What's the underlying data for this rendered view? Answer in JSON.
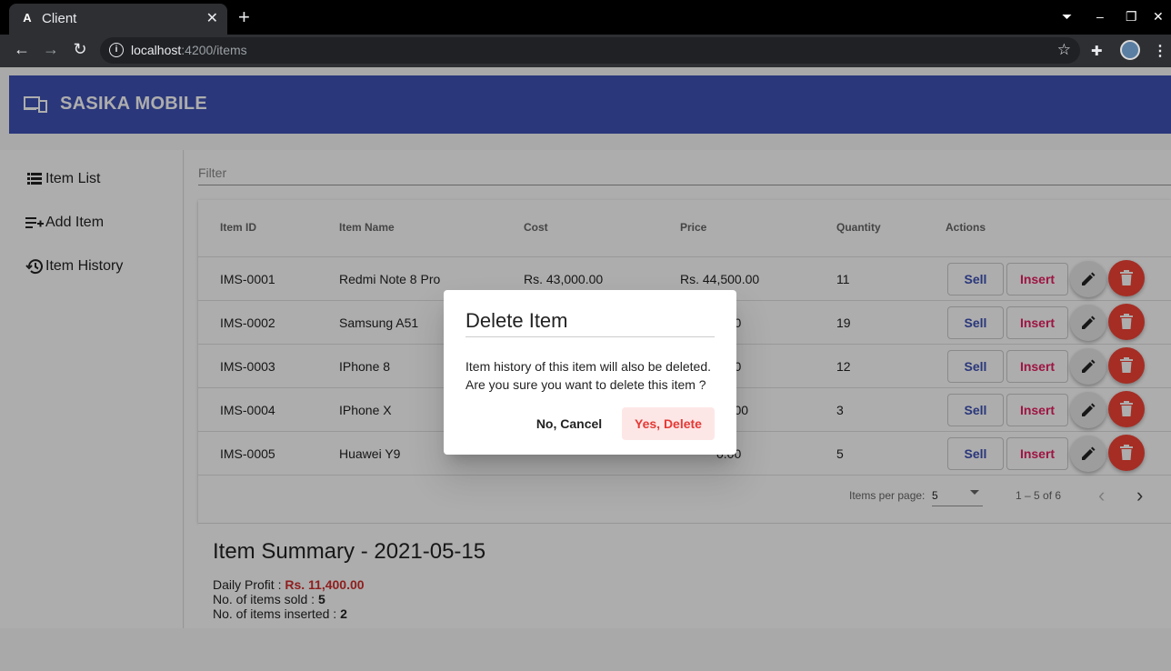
{
  "browser": {
    "tab_title": "Client",
    "url_host": "localhost",
    "url_path": ":4200/items"
  },
  "app": {
    "brand": "SASIKA MOBILE",
    "accent_color": "#3f51b5",
    "nav": [
      {
        "label": "Item List",
        "icon": "list-icon"
      },
      {
        "label": "Add Item",
        "icon": "playlist-add-icon"
      },
      {
        "label": "Item History",
        "icon": "history-icon"
      }
    ],
    "filter_placeholder": "Filter",
    "table": {
      "headers": [
        "Item ID",
        "Item Name",
        "Cost",
        "Price",
        "Quantity",
        "Actions"
      ],
      "rows": [
        {
          "id": "IMS-0001",
          "name": "Redmi Note 8 Pro",
          "cost": "Rs. 43,000.00",
          "price": "Rs. 44,500.00",
          "qty": "11"
        },
        {
          "id": "IMS-0002",
          "name": "Samsung A51",
          "cost": "",
          "price": "0.00",
          "qty": "19"
        },
        {
          "id": "IMS-0003",
          "name": "IPhone 8",
          "cost": "",
          "price": "0.00",
          "qty": "12"
        },
        {
          "id": "IMS-0004",
          "name": "IPhone X",
          "cost": "",
          "price": "00.00",
          "qty": "3"
        },
        {
          "id": "IMS-0005",
          "name": "Huawei Y9",
          "cost": "",
          "price": "0.00",
          "qty": "5"
        }
      ],
      "sell_label": "Sell",
      "insert_label": "Insert"
    },
    "paginator": {
      "items_per_page_label": "Items per page:",
      "page_size": "5",
      "range": "1 – 5 of 6"
    },
    "summary": {
      "title": "Item Summary - 2021-05-15",
      "profit_label": "Daily Profit :",
      "profit_value": "Rs. 11,400.00",
      "sold_label": "No. of items sold :",
      "sold_value": "5",
      "inserted_label": "No. of items inserted :",
      "inserted_value": "2"
    }
  },
  "dialog": {
    "title": "Delete Item",
    "line1": "Item history of this item will also be deleted.",
    "line2": "Are you sure you want to delete this item ?",
    "cancel_label": "No, Cancel",
    "confirm_label": "Yes, Delete"
  }
}
